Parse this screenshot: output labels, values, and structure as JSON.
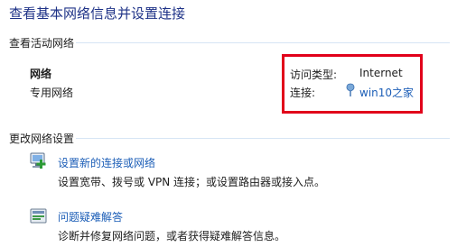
{
  "header": {
    "title": "查看基本网络信息并设置连接"
  },
  "active_networks": {
    "heading": "查看活动网络",
    "network": {
      "name": "网络",
      "type": "专用网络",
      "access_type_label": "访问类型:",
      "access_type_value": "Internet",
      "connection_label": "连接:",
      "connection_value": "win10之家"
    }
  },
  "change_settings": {
    "heading": "更改网络设置",
    "items": [
      {
        "title": "设置新的连接或网络",
        "desc": "设置宽带、拨号或 VPN 连接；或设置路由器或接入点。",
        "icon": "new-connection-icon"
      },
      {
        "title": "问题疑难解答",
        "desc": "诊断并修复网络问题，或者获得疑难解答信息。",
        "icon": "troubleshoot-icon"
      }
    ]
  },
  "colors": {
    "title": "#1e3287",
    "link": "#1c5eb7",
    "highlight": "#e1001a",
    "divider": "#d6e5f5"
  }
}
